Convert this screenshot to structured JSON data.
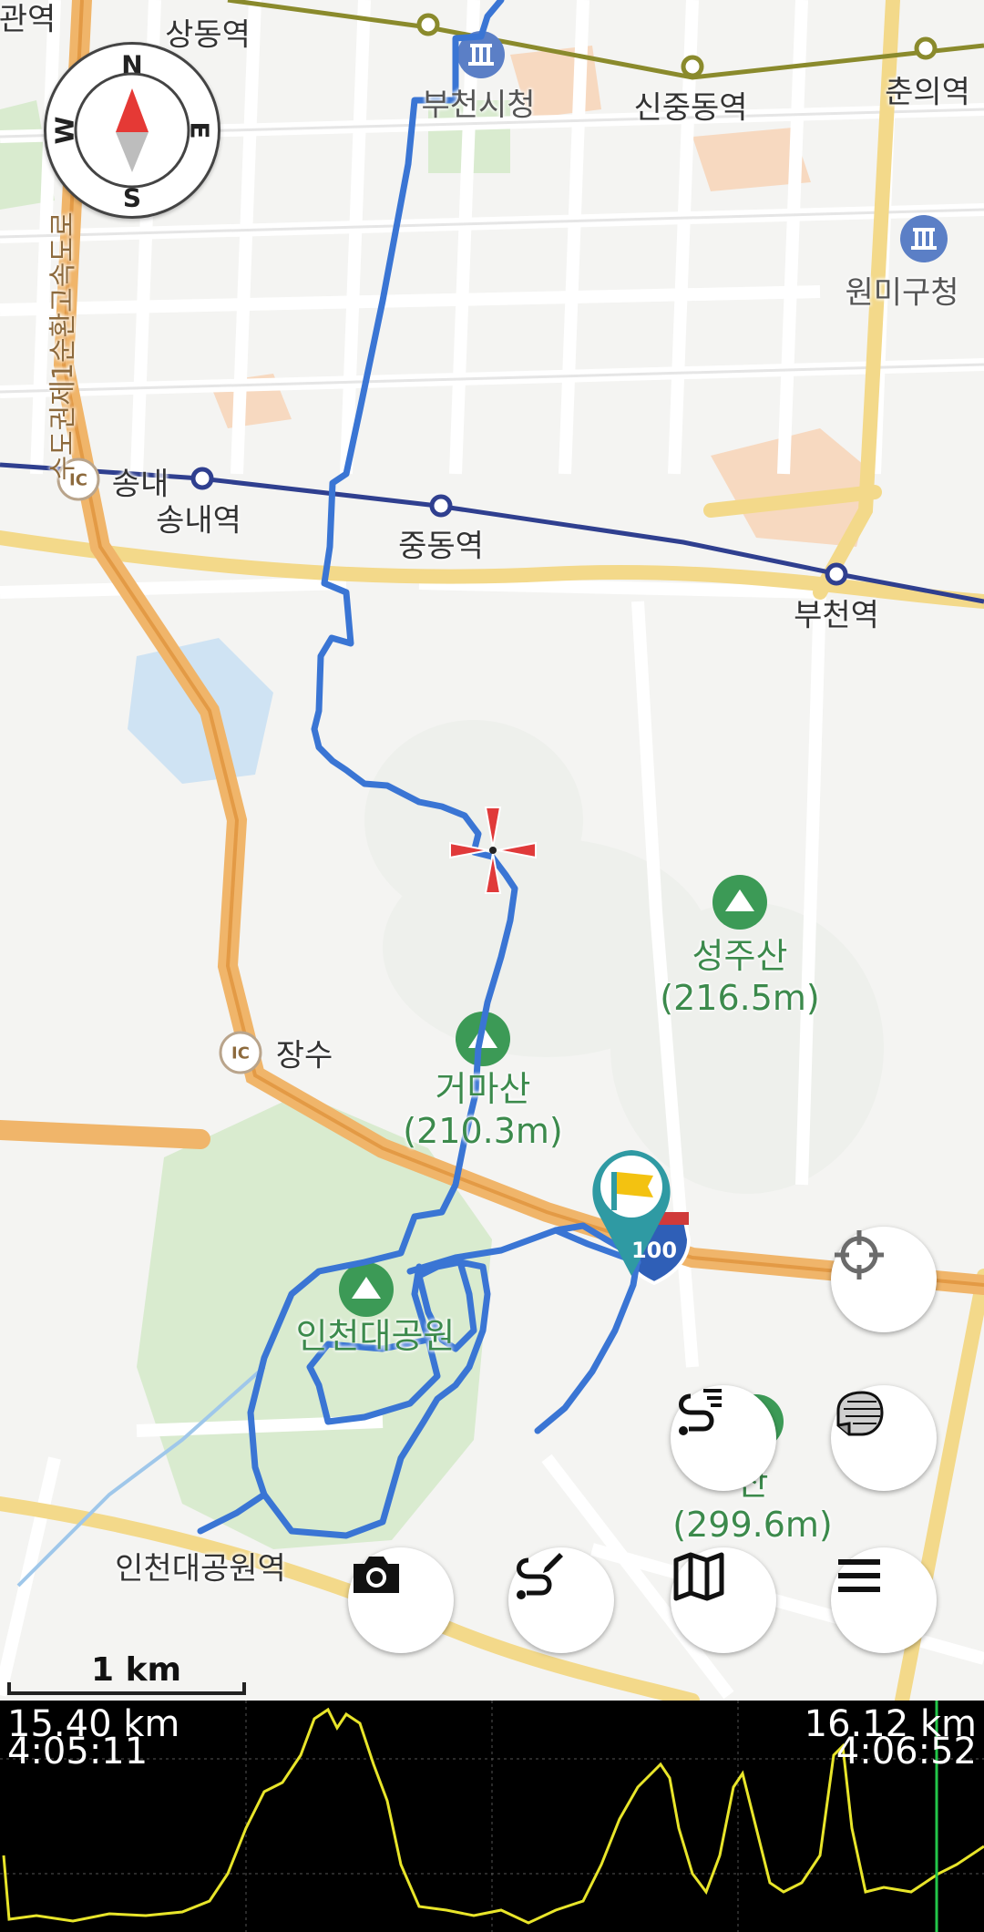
{
  "map": {
    "stations": [
      "상동역",
      "부천시청",
      "신중동역",
      "춘의역",
      "원미구청",
      "송내역",
      "중동역",
      "부천역",
      "인천대공원역",
      "관역"
    ],
    "ic_labels": [
      "송내",
      "장수"
    ],
    "road_label": "수도권제1순환고속도로",
    "mountains": [
      {
        "name": "성주산",
        "elevation": "(216.5m)"
      },
      {
        "name": "거마산",
        "elevation": "(210.3m)"
      },
      {
        "name": "산",
        "elevation": "(299.6m)"
      }
    ],
    "park_label": "인천대공원",
    "highway_shield": "100",
    "ic_badge": "IC",
    "scale_label": "1 km",
    "compass": {
      "n": "N",
      "s": "S",
      "e": "E",
      "w": "W"
    }
  },
  "profile": {
    "left_distance": "15.40 km",
    "left_time": "4:05:11",
    "right_distance": "16.12 km",
    "right_time": "4:06:52"
  },
  "colors": {
    "track": "#3a75d4",
    "profile_line": "#e8e52a",
    "cursor": "#23c64a",
    "flag_pin": "#2f9aa3"
  }
}
